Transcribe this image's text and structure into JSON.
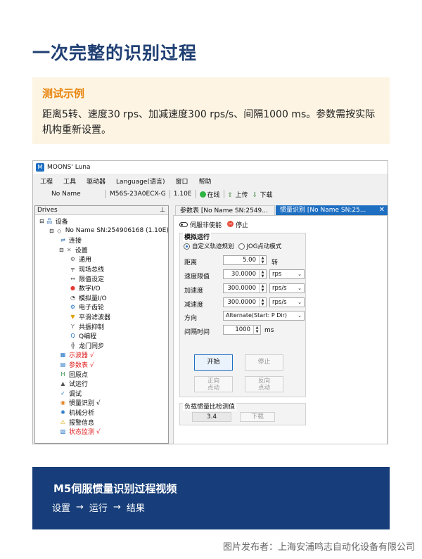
{
  "page": {
    "title": "一次完整的识别过程",
    "example_heading": "测试示例",
    "example_text": "距离5转、速度30 rps、加减速度300 rps/s、间隔1000 ms。参数需按实际机构重新设置。"
  },
  "app": {
    "window_title": "MOONS' Luna",
    "menu": [
      "工程",
      "工具",
      "驱动器",
      "Language(语言)",
      "窗口",
      "帮助"
    ],
    "toolbar": {
      "device_name": "No Name",
      "model": "M56S-23A0ECX-G",
      "version": "1.10E",
      "online_label": "在线",
      "upload_label": "上传",
      "download_label": "下载"
    },
    "drives": {
      "header": "Drives",
      "pin_icon": "pin-icon",
      "tree": [
        {
          "label": "设备",
          "icon": "network-icon",
          "level": 0,
          "expand": "⊟",
          "alert": false
        },
        {
          "label": "No Name SN:254906168  (1.10E)",
          "icon": "drive-icon",
          "level": 1,
          "expand": "⊟",
          "alert": false
        },
        {
          "label": "连接",
          "icon": "connect-icon",
          "level": 2,
          "expand": "",
          "alert": false
        },
        {
          "label": "设置",
          "icon": "tools-icon",
          "level": 2,
          "expand": "⊟",
          "alert": false
        },
        {
          "label": "通用",
          "icon": "gear-icon",
          "level": 3,
          "expand": "",
          "alert": false
        },
        {
          "label": "现场总线",
          "icon": "bus-icon",
          "level": 3,
          "expand": "",
          "alert": false
        },
        {
          "label": "限值设定",
          "icon": "limit-icon",
          "level": 3,
          "expand": "",
          "alert": false
        },
        {
          "label": "数字I/O",
          "icon": "digital-io-icon",
          "level": 3,
          "expand": "",
          "alert": false
        },
        {
          "label": "模拟量I/O",
          "icon": "analog-io-icon",
          "level": 3,
          "expand": "",
          "alert": false
        },
        {
          "label": "电子齿轮",
          "icon": "gear-ratio-icon",
          "level": 3,
          "expand": "",
          "alert": false
        },
        {
          "label": "平滑滤波器",
          "icon": "filter-icon",
          "level": 3,
          "expand": "",
          "alert": false
        },
        {
          "label": "共振抑制",
          "icon": "resonance-icon",
          "level": 3,
          "expand": "",
          "alert": false
        },
        {
          "label": "Q编程",
          "icon": "q-program-icon",
          "level": 3,
          "expand": "",
          "alert": false
        },
        {
          "label": "龙门同步",
          "icon": "gantry-icon",
          "level": 3,
          "expand": "",
          "alert": false
        },
        {
          "label": "示波器 √",
          "icon": "oscilloscope-icon",
          "level": 2,
          "expand": "",
          "alert": true
        },
        {
          "label": "参数表 √",
          "icon": "param-table-icon",
          "level": 2,
          "expand": "",
          "alert": true
        },
        {
          "label": "回原点",
          "icon": "home-icon",
          "level": 2,
          "expand": "",
          "alert": false
        },
        {
          "label": "试运行",
          "icon": "test-run-icon",
          "level": 2,
          "expand": "",
          "alert": false
        },
        {
          "label": "调试",
          "icon": "tuning-icon",
          "level": 2,
          "expand": "",
          "alert": false
        },
        {
          "label": "惯量识别 √",
          "icon": "inertia-icon",
          "level": 2,
          "expand": "",
          "alert": false
        },
        {
          "label": "机械分析",
          "icon": "mech-analysis-icon",
          "level": 2,
          "expand": "",
          "alert": false
        },
        {
          "label": "报警信息",
          "icon": "warning-icon",
          "level": 2,
          "expand": "",
          "alert": false
        },
        {
          "label": "状态监测 √",
          "icon": "status-monitor-icon",
          "level": 2,
          "expand": "",
          "alert": true
        }
      ]
    },
    "tabs": {
      "params": "参数表 [No Name SN:2549...",
      "inertia": "惯量识别 [No Name SN:25...",
      "close": "✕"
    },
    "panel": {
      "servo_off_label": "伺服非使能",
      "stop_label": "停止",
      "group_title": "模拟运行",
      "mode_custom": "自定义轨迹规划",
      "mode_jog": "JOG点动模式",
      "distance_label": "距离",
      "distance_value": "5.00",
      "distance_unit": "转",
      "speed_label": "速度限值",
      "speed_value": "30.0000",
      "speed_unit": "rps",
      "accel_label": "加速度",
      "accel_value": "300.0000",
      "accel_unit": "rps/s",
      "decel_label": "减速度",
      "decel_value": "300.0000",
      "decel_unit": "rps/s",
      "direction_label": "方向",
      "direction_value": "Alternate(Start: P Dir)",
      "interval_label": "间隔时间",
      "interval_value": "1000",
      "interval_unit": "ms",
      "start_button": "开始",
      "stop_button": "停止",
      "forward_jog_line1": "正向",
      "forward_jog_line2": "点动",
      "reverse_jog_line1": "反向",
      "reverse_jog_line2": "点动",
      "ratio_title": "负载惯量比检测值",
      "ratio_value": "3.4",
      "download_button": "下载"
    }
  },
  "video": {
    "title": "M5伺服惯量识别过程视频",
    "steps": [
      "设置",
      "运行",
      "结果"
    ],
    "arrow": "→"
  },
  "footer": {
    "credit": "图片发布者：上海安浦鸣志自动化设备有限公司"
  }
}
